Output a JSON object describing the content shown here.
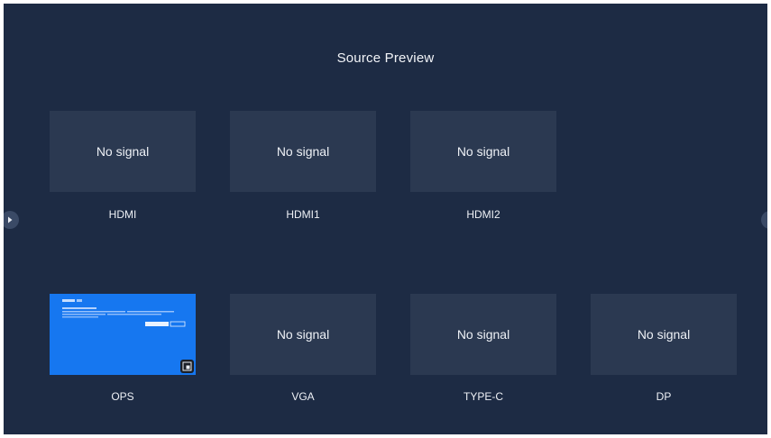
{
  "page": {
    "title": "Source Preview"
  },
  "sources": {
    "hdmi": {
      "status": "No signal",
      "label": "HDMI"
    },
    "hdmi1": {
      "status": "No signal",
      "label": "HDMI1"
    },
    "hdmi2": {
      "status": "No signal",
      "label": "HDMI2"
    },
    "ops": {
      "label": "OPS",
      "preview": "ops-desktop-preview"
    },
    "vga": {
      "status": "No signal",
      "label": "VGA"
    },
    "typec": {
      "status": "No signal",
      "label": "TYPE-C"
    },
    "dp": {
      "status": "No signal",
      "label": "DP"
    }
  },
  "icons": {
    "left_arrow": "chevron-right-icon",
    "right_arrow": "chevron-left-icon",
    "ops_badge": "expand-icon"
  },
  "colors": {
    "background": "#1d2b44",
    "tile": "#2b3951",
    "ops_preview": "#1677f0",
    "text": "#eef1f6"
  }
}
